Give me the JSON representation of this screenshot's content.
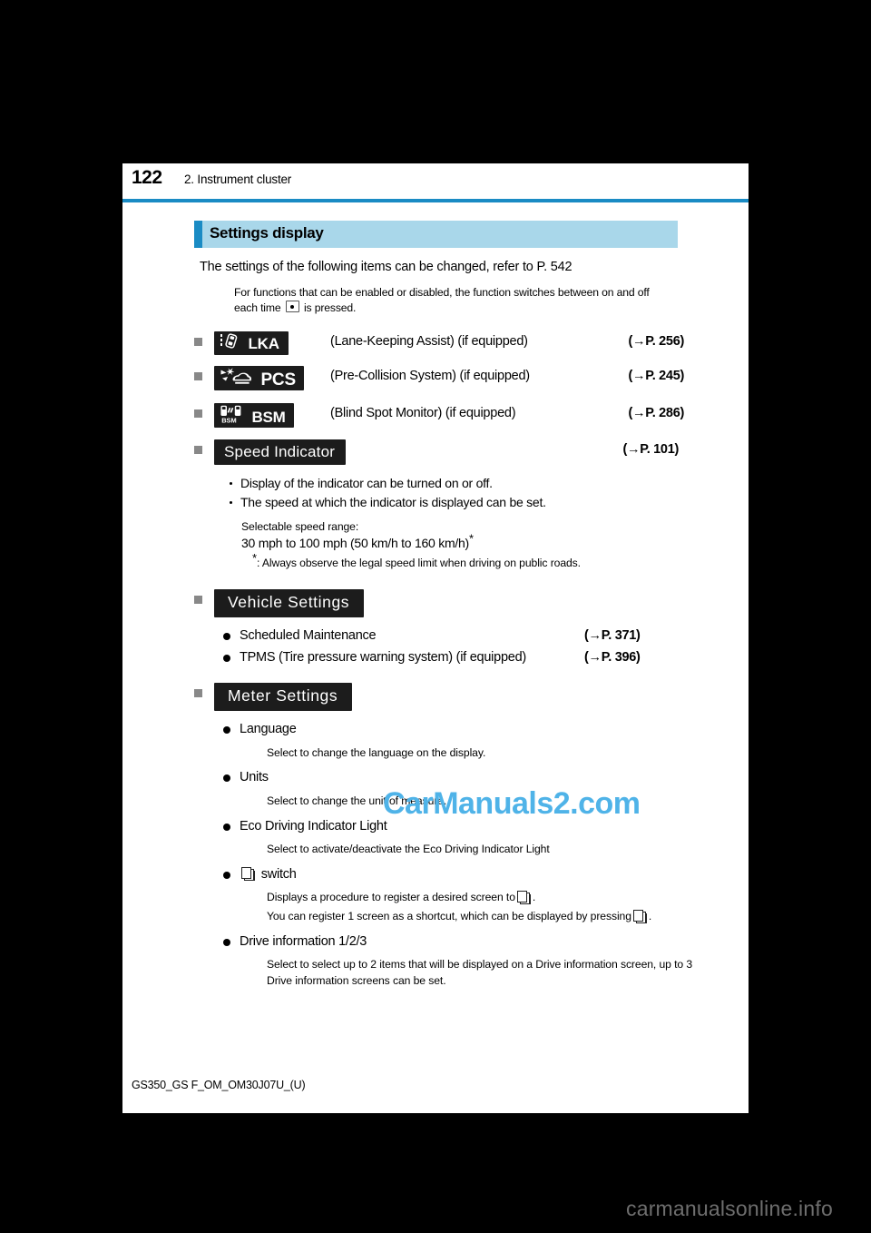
{
  "page": {
    "number": "122",
    "chapter_title": "2. Instrument cluster",
    "document_code": "GS350_GS F_OM_OM30J07U_(U)"
  },
  "colors": {
    "rule_blue": "#1a8bc4",
    "heading_band": "#a9d7ea",
    "heading_accent": "#1a8bc4",
    "chip_dark": "#1c1c1c",
    "square_bullet": "#888888",
    "watermark_blue": "#4fb3e8"
  },
  "section": {
    "heading": "Settings display",
    "intro": "The settings of the following items can be changed, refer to P. 542",
    "note": {
      "text_before_key": "For functions that can be enabled or disabled, the function switches between on and off each time",
      "key_icon": "enter-dot-button-icon",
      "text_after_key": "is pressed."
    }
  },
  "settings_items": [
    {
      "chip_label": "LKA",
      "chip_icon": "lane-keeping-assist-icon",
      "caption": "(Lane-Keeping Assist) (if equipped)",
      "ref_prefix": "(",
      "ref_arrow": "→",
      "ref_page": "P. 256",
      "ref_suffix": ")"
    },
    {
      "chip_label": "PCS",
      "chip_icon": "pre-collision-system-icon",
      "caption": "(Pre-Collision System) (if equipped)",
      "ref_prefix": "(",
      "ref_arrow": "→",
      "ref_page": "P. 245",
      "ref_suffix": ")"
    },
    {
      "chip_label": "BSM",
      "chip_icon": "blind-spot-monitor-icon",
      "caption": "(Blind Spot Monitor) (if equipped)",
      "ref_prefix": "(",
      "ref_arrow": "→",
      "ref_page": "P. 286",
      "ref_suffix": ")"
    }
  ],
  "speed_indicator": {
    "chip_label": "Speed Indicator",
    "ref_prefix": "(",
    "ref_arrow": "→",
    "ref_page": "P. 101",
    "ref_suffix": ")",
    "bullets": [
      "Display of the indicator can be turned on or off.",
      "The speed at which the indicator is displayed can be set."
    ],
    "range_label": "Selectable speed range:",
    "range_value": "30 mph to 100 mph (50 km/h to 160 km/h)",
    "range_star": "*",
    "footnote_star": "*",
    "footnote_text": ": Always observe the legal speed limit when driving on public roads."
  },
  "vehicle_settings": {
    "chip_label": "Vehicle Settings",
    "items": [
      {
        "label": "Scheduled Maintenance",
        "ref_prefix": "(",
        "ref_arrow": "→",
        "ref_page": "P. 371",
        "ref_suffix": ")"
      },
      {
        "label": "TPMS (Tire pressure warning system) (if equipped)",
        "ref_prefix": "(",
        "ref_arrow": "→",
        "ref_page": "P. 396",
        "ref_suffix": ")"
      }
    ]
  },
  "meter_settings": {
    "chip_label": "Meter Settings",
    "items": [
      {
        "label": "Language",
        "descriptions": [
          "Select to change the language on the display."
        ]
      },
      {
        "label": "Units",
        "descriptions": [
          "Select to change the unit of measure."
        ]
      },
      {
        "label": "Eco Driving Indicator Light",
        "descriptions": [
          "Select to activate/deactivate the Eco Driving Indicator Light"
        ]
      },
      {
        "label_icon": "screen-shortcut-icon",
        "label": "switch",
        "descriptions": [
          "Displays a procedure to register a desired screen to",
          "You can register 1 screen as a shortcut, which can be displayed by pressing"
        ]
      },
      {
        "label": "Drive information 1/2/3",
        "descriptions": [
          "Select to select up to 2 items that will be displayed on a Drive information screen, up to 3 Drive information screens can be set."
        ]
      }
    ]
  },
  "watermarks": {
    "overlay": "CarManuals2.com",
    "bottom": "carmanualsonline.info"
  }
}
